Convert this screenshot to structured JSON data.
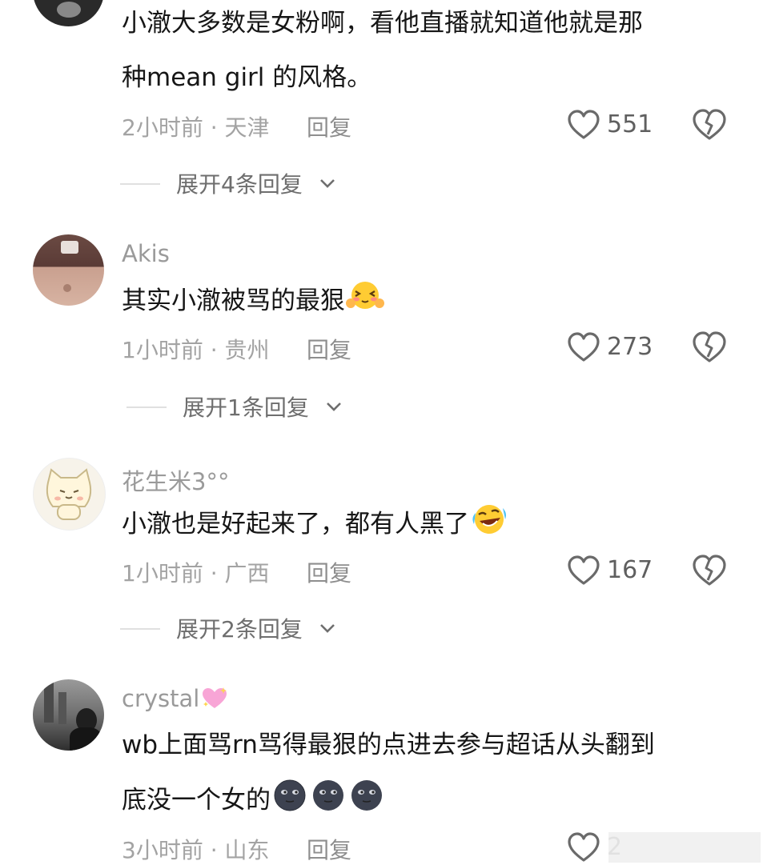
{
  "comments": [
    {
      "username": "",
      "text_lines": [
        "小澈大多数是女粉啊，看他直播就知道他就是那",
        "种mean girl 的风格。"
      ],
      "time": "2小时前",
      "location": "天津",
      "reply_label": "回复",
      "likes": "551",
      "expand_label": "展开4条回复"
    },
    {
      "username": "Akis",
      "text_lines": [
        "其实小澈被骂的最狠"
      ],
      "time": "1小时前",
      "location": "贵州",
      "reply_label": "回复",
      "likes": "273",
      "expand_label": "展开1条回复"
    },
    {
      "username": "花生米3°°",
      "text_lines": [
        "小澈也是好起来了，都有人黑了"
      ],
      "time": "1小时前",
      "location": "广西",
      "reply_label": "回复",
      "likes": "167",
      "expand_label": "展开2条回复"
    },
    {
      "username": "crystal",
      "text_lines": [
        "wb上面骂rn骂得最狠的点进去参与超话从头翻到",
        "底没一个女的"
      ],
      "time": "3小时前",
      "location": "山东",
      "reply_label": "回复",
      "likes": "2"
    }
  ],
  "icons": {
    "like": "heart-outline-icon",
    "dislike": "broken-heart-icon",
    "expand": "chevron-down-icon",
    "emoji_blush": "blushing-face-emoji",
    "emoji_laugh": "crying-laughing-emoji",
    "emoji_moon": "new-moon-face-emoji",
    "emoji_heart": "sparkling-heart-emoji"
  }
}
